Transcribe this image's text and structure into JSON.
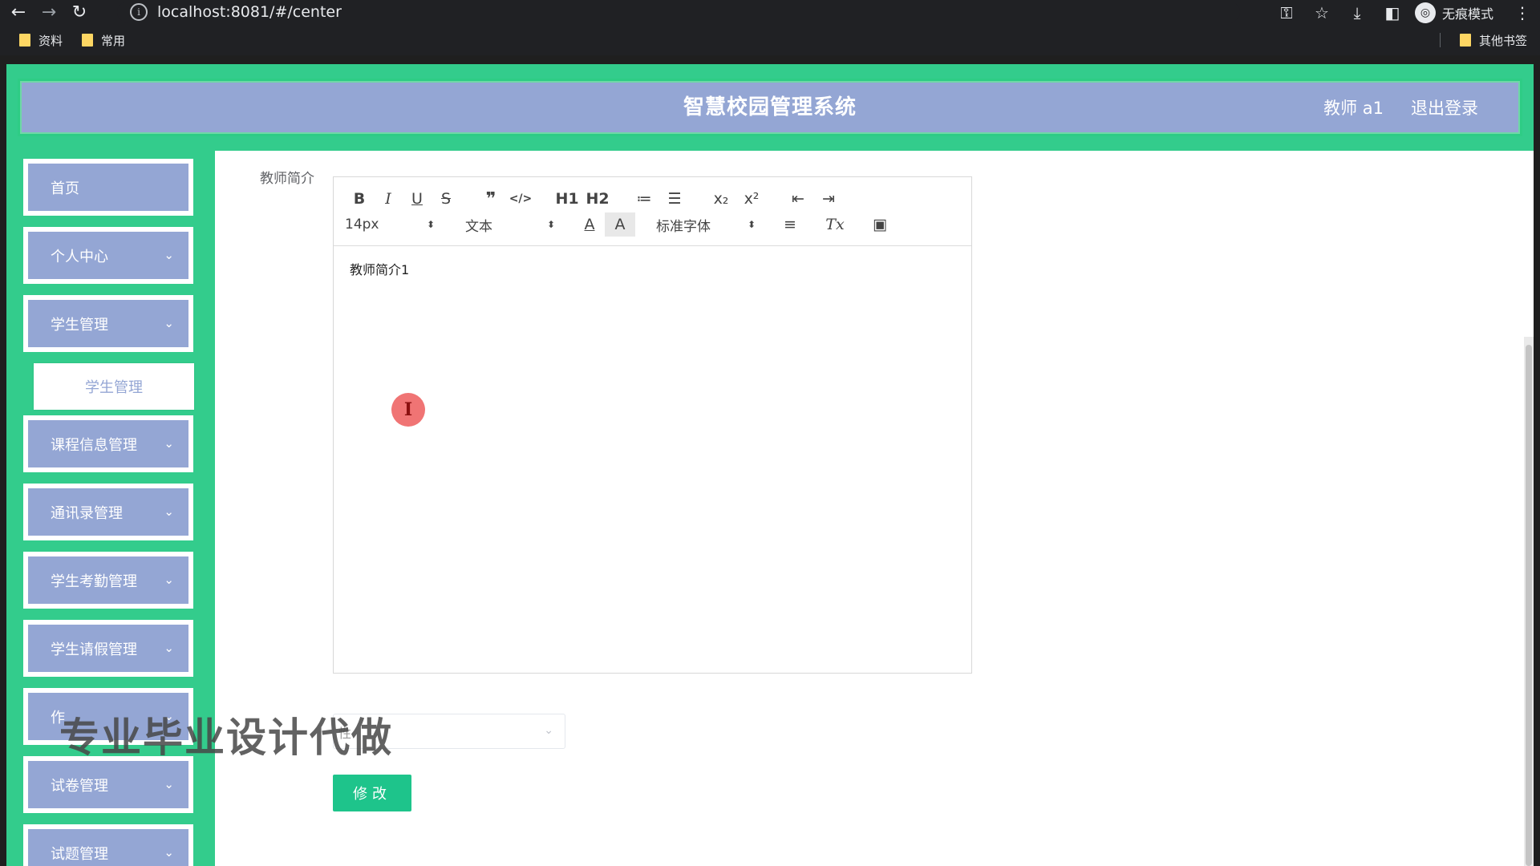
{
  "browser": {
    "url": "localhost:8081/#/center",
    "incognito_label": "无痕模式",
    "bookmarks": [
      "资料",
      "常用"
    ],
    "other_bookmarks": "其他书签"
  },
  "header": {
    "title": "智慧校园管理系统",
    "user": "教师 a1",
    "logout": "退出登录"
  },
  "sidebar": {
    "items": [
      {
        "label": "首页"
      },
      {
        "label": "个人中心"
      },
      {
        "label": "学生管理"
      },
      {
        "label": "课程信息管理"
      },
      {
        "label": "通讯录管理"
      },
      {
        "label": "学生考勤管理"
      },
      {
        "label": "学生请假管理"
      },
      {
        "label": "作"
      },
      {
        "label": "试卷管理"
      },
      {
        "label": "试题管理"
      }
    ],
    "submenu": {
      "label": "学生管理"
    }
  },
  "form": {
    "intro_label": "教师简介",
    "intro_content": "教师简介1",
    "select_partial": "性",
    "submit_label": "修改"
  },
  "editor": {
    "font_size": "14px",
    "header_select": "文本",
    "font_family": "标准字体",
    "toolbar_labels": {
      "bold": "B",
      "italic": "I",
      "underline": "U",
      "strike": "S",
      "quote": "❞",
      "code": "</>",
      "h1": "H1",
      "h2": "H2",
      "ordered": "≔",
      "bullet": "☰",
      "sub": "x₂",
      "sup": "x²",
      "outdent": "⇤",
      "indent": "⇥",
      "color": "A",
      "background": "A",
      "align": "≡",
      "clean": "Tx",
      "image": "▣"
    }
  },
  "watermark": "专业毕业设计代做",
  "cursor_icon": "I"
}
